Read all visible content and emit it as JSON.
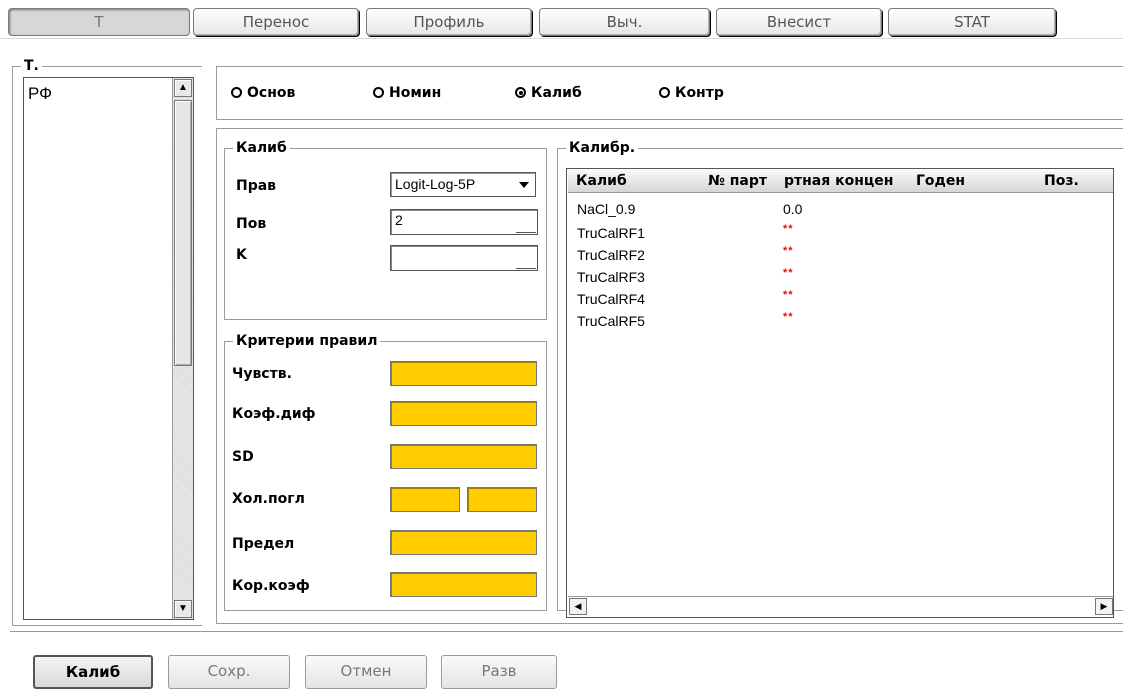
{
  "tabs": [
    {
      "label": "T",
      "active": true
    },
    {
      "label": "Перенос"
    },
    {
      "label": "Профиль"
    },
    {
      "label": "Выч."
    },
    {
      "label": "Внесист"
    },
    {
      "label": "STAT"
    }
  ],
  "left_panel": {
    "title": "Т.",
    "items": [
      "РФ"
    ]
  },
  "radios": [
    {
      "label": "Основ",
      "selected": false
    },
    {
      "label": "Номин",
      "selected": false
    },
    {
      "label": "Калиб",
      "selected": true
    },
    {
      "label": "Контр",
      "selected": false
    }
  ],
  "calib_group": {
    "title": "Калиб",
    "rule_label": "Прав",
    "rule_value": "Logit-Log-5P",
    "rep_label": "Пов",
    "rep_value": "2",
    "k_label": "K",
    "k_value": ""
  },
  "criteria_group": {
    "title": "Критерии правил",
    "labels": [
      "Чувств.",
      "Коэф.диф",
      "SD",
      "Хол.погл",
      "Предел",
      "Кор.коэф"
    ],
    "field_color": "#ffcc00"
  },
  "calibrators": {
    "title": "Калибр.",
    "columns": [
      "Калиб",
      "№ парт",
      "ртная концен",
      "Годен",
      "Поз."
    ],
    "rows": [
      {
        "name": "NaCl_0.9",
        "conc": "0.0"
      },
      {
        "name": "TruCalRF1",
        "conc": "**"
      },
      {
        "name": "TruCalRF2",
        "conc": "**"
      },
      {
        "name": "TruCalRF3",
        "conc": "**"
      },
      {
        "name": "TruCalRF4",
        "conc": "**"
      },
      {
        "name": "TruCalRF5",
        "conc": "**"
      }
    ]
  },
  "buttons": {
    "calib": "Калиб",
    "save": "Сохр.",
    "cancel": "Отмен",
    "expand": "Разв"
  },
  "colors": {
    "pending_value": "#e01010"
  }
}
